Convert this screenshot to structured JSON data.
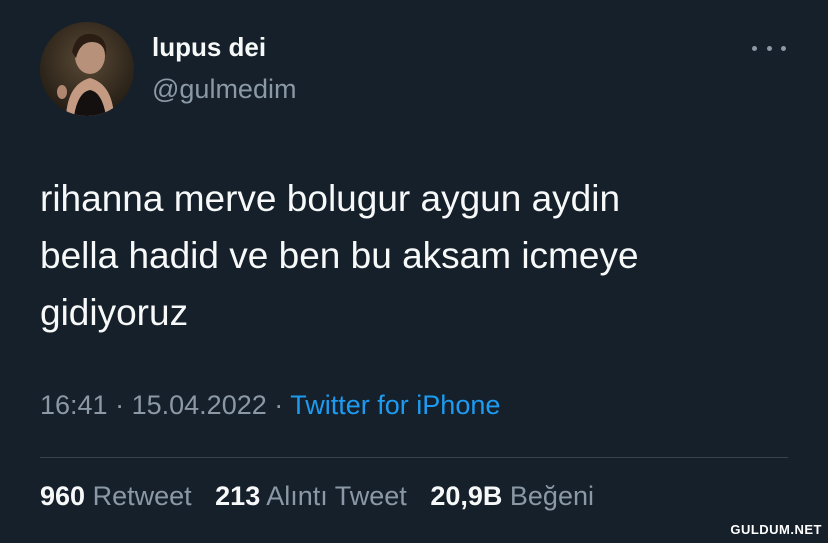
{
  "user": {
    "display_name": "lupus dei",
    "handle": "@gulmedim"
  },
  "menu": {
    "icon": "more-horizontal-icon"
  },
  "tweet": {
    "lines": [
      "rihanna merve bolugur aygun aydin",
      "bella hadid ve ben bu aksam icmeye",
      "gidiyoruz"
    ],
    "time": "16:41",
    "separator": "·",
    "date": "15.04.2022",
    "source": "Twitter for iPhone"
  },
  "stats": {
    "retweets_count": "960",
    "retweets_label": "Retweet",
    "quotes_count": "213",
    "quotes_label": "Alıntı Tweet",
    "likes_count": "20,9B",
    "likes_label": "Beğeni"
  },
  "watermark": "GULDUM.NET",
  "colors": {
    "background": "#15202b",
    "text": "#f7f9f9",
    "muted": "#8b98a5",
    "link": "#1d9bf0",
    "divider": "#38444d"
  }
}
